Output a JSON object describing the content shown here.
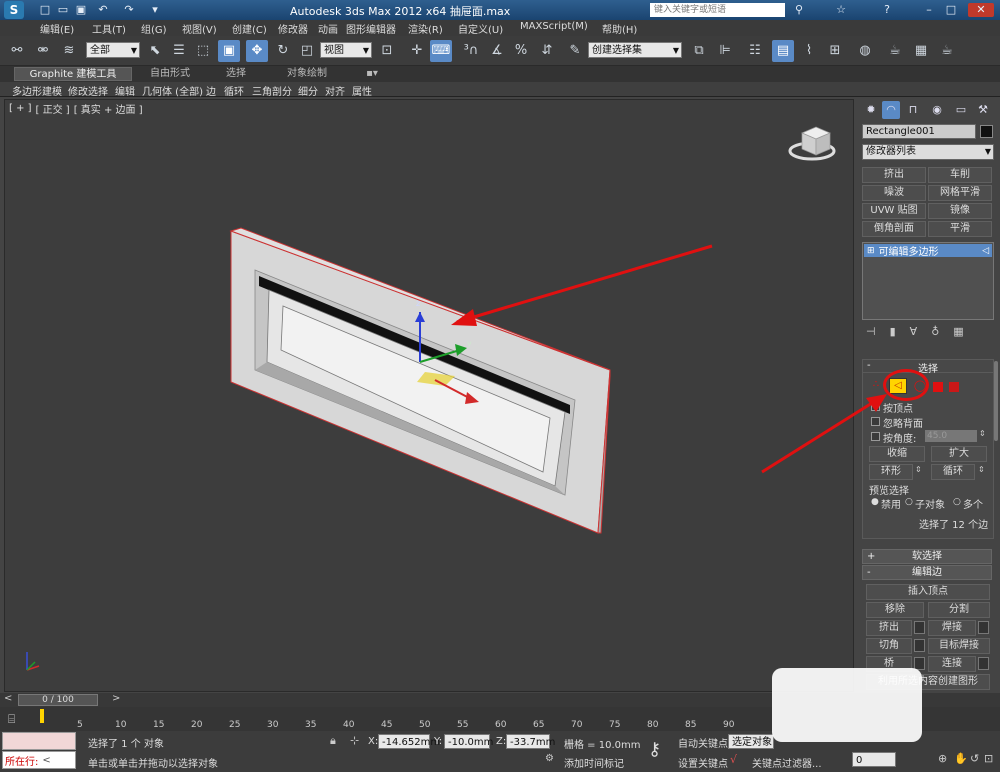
{
  "titlebar": {
    "title": "Autodesk 3ds Max  2012 x64     抽屉面.max",
    "search_placeholder": "键入关键字或短语"
  },
  "menu": [
    "编辑(E)",
    "工具(T)",
    "组(G)",
    "视图(V)",
    "创建(C)",
    "修改器",
    "动画",
    "图形编辑器",
    "渲染(R)",
    "自定义(U)",
    "MAXScript(M)",
    "帮助(H)"
  ],
  "toolbar": {
    "selection_filter": "全部",
    "ref_coord": "视图",
    "named_selection": "创建选择集"
  },
  "ribbon": {
    "tabs": [
      "Graphite 建模工具",
      "自由形式",
      "选择",
      "对象绘制"
    ],
    "items": [
      "多边形建模",
      "修改选择",
      "编辑",
      "几何体 (全部)",
      "边",
      "循环",
      "三角剖分",
      "细分",
      "对齐",
      "属性"
    ]
  },
  "viewport": {
    "label": "[ + ] 正交 ] 真实 + 边面 ]",
    "label_parts": [
      "[ + ]",
      "[ 正交 ]",
      "[ 真实 + 边面 ]"
    ],
    "gizmo_axes": [
      "z",
      "y",
      "x"
    ]
  },
  "cmdpanel": {
    "object_name": "Rectangle001",
    "modifier_list": "修改器列表",
    "modifier_buttons": [
      "挤出",
      "车削",
      "噪波",
      "网格平滑",
      "UVW 贴图",
      "镜像",
      "倒角剖面",
      "平滑"
    ],
    "stack_item": "可编辑多边形",
    "selection_rollout": "选择",
    "by_vertex": "按顶点",
    "ignore_backfacing": "忽略背面",
    "by_angle": "按角度:",
    "angle_value": "45.0",
    "shrink": "收缩",
    "grow": "扩大",
    "ring": "环形",
    "loop": "循环",
    "preview_selection": "预览选择",
    "preview_disabled": "禁用",
    "preview_subobject": "子对象",
    "preview_multi": "多个",
    "selection_status": "选择了 12 个边",
    "soft_selection": "软选择",
    "edit_edges": "编辑边",
    "insert_vertex": "插入顶点",
    "remove": "移除",
    "split": "分割",
    "extrude": "挤出",
    "weld": "焊接",
    "chamfer": "切角",
    "target_weld": "目标焊接",
    "bridge": "桥",
    "connect": "连接",
    "create_shape": "利用所选内容创建图形"
  },
  "timeslider": {
    "frame": "0 / 100"
  },
  "trackbar": {
    "ticks": [
      "0",
      "5",
      "10",
      "15",
      "20",
      "25",
      "30",
      "35",
      "40",
      "45",
      "50",
      "55",
      "60",
      "65",
      "70",
      "75",
      "80",
      "85",
      "90"
    ]
  },
  "status": {
    "in_progress": "所在行:",
    "message_top": "选择了 1 个 对象",
    "message_bottom": "单击或单击并拖动以选择对象",
    "x_label": "X:",
    "x_value": "-14.652mm",
    "y_label": "Y:",
    "y_value": "-10.0mm",
    "z_label": "Z:",
    "z_value": "-33.7mm",
    "grid": "栅格 = 10.0mm",
    "add_time_tag": "添加时间标记",
    "auto_key": "自动关键点",
    "selected_objects": "选定对象",
    "set_key": "设置关键点",
    "key_filters": "关键点过滤器...",
    "frame_value": "0"
  },
  "colors": {
    "accent": "#5a8ac6",
    "annotation_red": "#e01010",
    "viewport_bg": "#3d3d3d"
  }
}
